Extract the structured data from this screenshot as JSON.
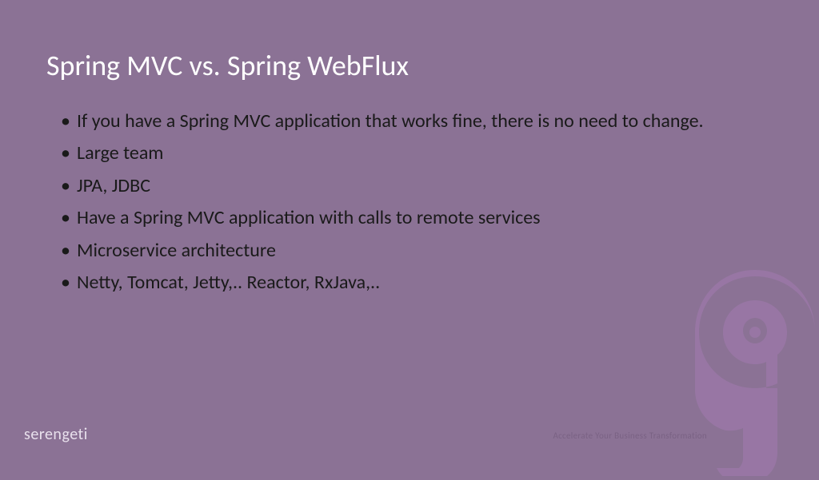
{
  "slide": {
    "title": "Spring MVC vs. Spring WebFlux",
    "bullets": [
      "If you have a Spring MVC application that works fine, there is no need to change.",
      "Large team",
      "JPA, JDBC",
      "Have a Spring MVC application with calls to remote services",
      "Microservice architecture",
      "Netty, Tomcat, Jetty,.. Reactor, RxJava,.."
    ]
  },
  "footer": {
    "brand": "serengeti",
    "tagline": "Accelerate Your Business Transformation"
  }
}
